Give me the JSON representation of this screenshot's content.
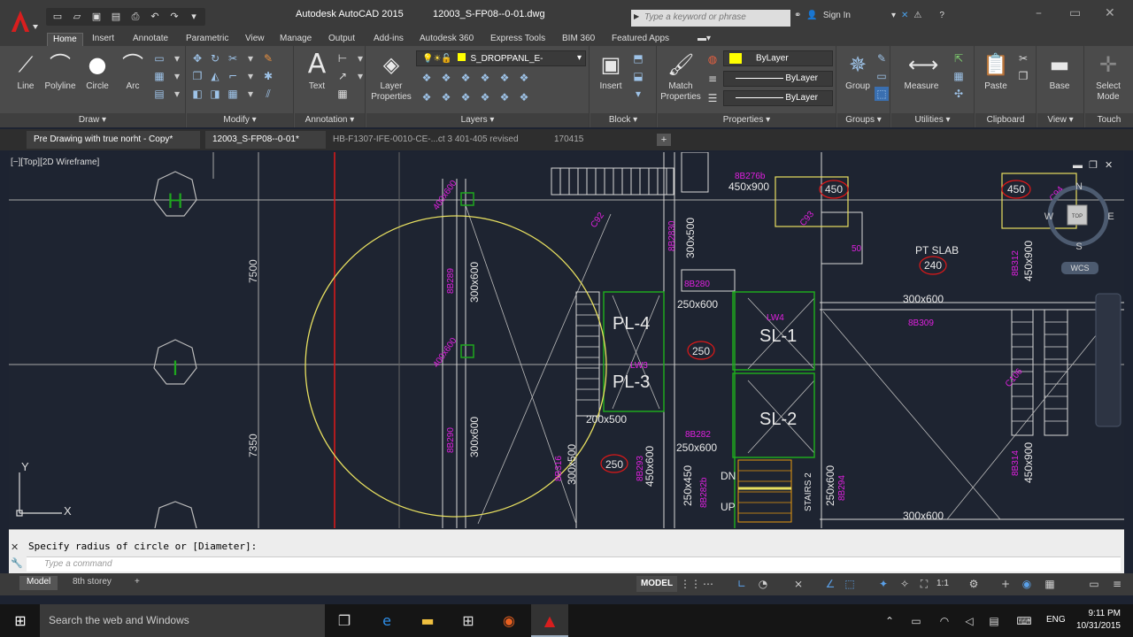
{
  "window": {
    "app_title": "Autodesk AutoCAD 2015",
    "file_title": "12003_S-FP08--0-01.dwg",
    "search_placeholder": "Type a keyword or phrase",
    "sign_in": "Sign In"
  },
  "ribbon_tabs": [
    "Home",
    "Insert",
    "Annotate",
    "Parametric",
    "View",
    "Manage",
    "Output",
    "Add-ins",
    "Autodesk 360",
    "Express Tools",
    "BIM 360",
    "Featured Apps"
  ],
  "ribbon": {
    "draw": {
      "title": "Draw",
      "line": "Line",
      "polyline": "Polyline",
      "circle": "Circle",
      "arc": "Arc"
    },
    "modify": {
      "title": "Modify"
    },
    "annotation": {
      "title": "Annotation",
      "text": "Text"
    },
    "layers": {
      "title": "Layers",
      "layer_properties_1": "Layer",
      "layer_properties_2": "Properties",
      "current_layer": "S_DROPPANL_E-"
    },
    "block": {
      "title": "Block",
      "insert": "Insert"
    },
    "properties": {
      "title": "Properties",
      "match_1": "Match",
      "match_2": "Properties",
      "color": "ByLayer",
      "linetype": "ByLayer",
      "lineweight": "ByLayer"
    },
    "groups": {
      "title": "Groups",
      "group": "Group"
    },
    "utilities": {
      "title": "Utilities",
      "measure": "Measure"
    },
    "clipboard": {
      "title": "Clipboard",
      "paste": "Paste"
    },
    "view": {
      "title": "View",
      "base": "Base"
    },
    "touch": {
      "title": "Touch",
      "select_1": "Select",
      "select_2": "Mode"
    }
  },
  "doc_tabs": [
    "Pre Drawing with true norht - Copy*",
    "12003_S-FP08--0-01*",
    "HB-F1307-IFE-0010-CE-...ct 3 401-405 revised",
    "170415"
  ],
  "viewport_label": "[−][Top][2D Wireframe]",
  "drawing": {
    "grid_labels": [
      "H",
      "I"
    ],
    "dimensions": [
      "7500",
      "7350"
    ],
    "beams": [
      "300x600",
      "300x600",
      "300x500",
      "450x900",
      "250x600",
      "250x600",
      "200x500",
      "300x500",
      "450x600",
      "250x450",
      "250x600",
      "300x600",
      "300x600",
      "450x900",
      "450x900"
    ],
    "beam_tags": [
      "8B276b",
      "8B280",
      "8B289",
      "8B309",
      "8B282",
      "8B293",
      "8B312",
      "8B314",
      "8B290",
      "8B316",
      "8B282b",
      "8B294",
      "8B2830"
    ],
    "column_tags": [
      "C92",
      "C93",
      "C94",
      "C106"
    ],
    "panels": [
      "PL-4",
      "PL-3",
      "SL-1",
      "SL-2"
    ],
    "wall_tags": [
      "LW4",
      "LW3"
    ],
    "slab_label": "PT SLAB",
    "slab_thickness": [
      "450",
      "450",
      "250",
      "250",
      "240"
    ],
    "other": [
      "50",
      "DN",
      "UP",
      "STAIRS 2",
      "400x600",
      "4TC6",
      "4TC6b",
      "C33"
    ],
    "compass": {
      "n": "N",
      "w": "W",
      "e": "E",
      "s": "S",
      "top": "TOP",
      "wcs": "WCS"
    },
    "ucs": {
      "y": "Y",
      "x": "X"
    }
  },
  "command": {
    "history": "Specify radius of circle or [Diameter]:",
    "placeholder": "Type a command"
  },
  "status": {
    "layout_tabs": [
      "Model",
      "8th storey"
    ],
    "model": "MODEL",
    "scale": "1:1"
  },
  "taskbar": {
    "search": "Search the web and Windows",
    "language": "ENG",
    "time": "9:11 PM",
    "date": "10/31/2015"
  },
  "colors": {
    "bg": "#1e2431",
    "magenta": "#e020e0",
    "green": "#1ea81e",
    "yellow": "#e8e060",
    "red": "#e01818",
    "white": "#e8e8e8"
  }
}
